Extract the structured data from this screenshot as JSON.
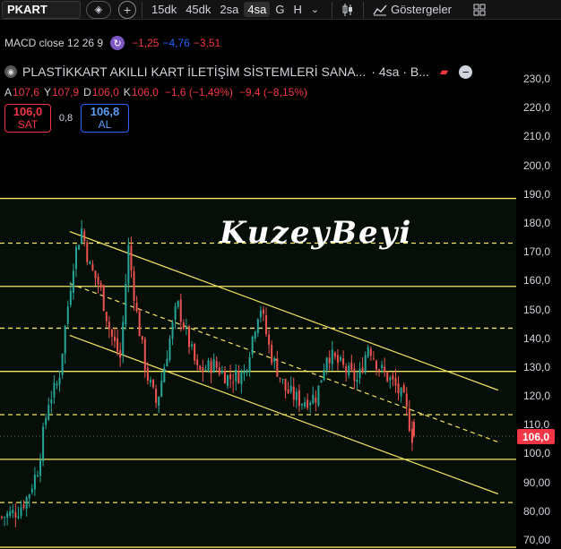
{
  "toolbar": {
    "symbol": "PKART",
    "timeframes": [
      "15dk",
      "45dk",
      "2sa",
      "4sa",
      "G",
      "H"
    ],
    "active_timeframe": "4sa",
    "indicators_label": "Göstergeler"
  },
  "macd": {
    "label": "MACD close 12 26 9",
    "v1": "−1,25",
    "v2": "−4,76",
    "v3": "−3,51"
  },
  "title": {
    "name": "PLASTİKKART AKILLI KART İLETİŞİM SİSTEMLERİ SANA...",
    "suffix": "· 4sa · B..."
  },
  "ohlc": {
    "a_label": "A",
    "a": "107,6",
    "y_label": "Y",
    "y": "107,9",
    "d_label": "D",
    "d": "106,0",
    "k_label": "K",
    "k": "106,0",
    "change": "−1,6 (−1,49%)",
    "change2": "−9,4 (−8,15%)"
  },
  "trade": {
    "sell_price": "106,0",
    "sell_label": "SAT",
    "spread": "0,8",
    "buy_price": "106,8",
    "buy_label": "AL"
  },
  "watermark": "KuzeyBeyi",
  "price_axis": {
    "ticks": [
      "230,0",
      "220,0",
      "210,0",
      "200,0",
      "190,0",
      "180,0",
      "170,0",
      "160,0",
      "150,0",
      "140,0",
      "130,0",
      "120,0",
      "110,0",
      "100,0",
      "90,00",
      "80,00",
      "70,00"
    ],
    "current": "106,0"
  },
  "colors": {
    "background": "#000000",
    "up": "#26a69a",
    "down": "#ef5350",
    "level_line": "#f5e663",
    "badge": "#f23645"
  },
  "chart_data": {
    "type": "candlestick",
    "ylim": [
      67,
      235
    ],
    "current_price": 106.0,
    "horizontal_levels": [
      {
        "price": 188.5,
        "style": "solid"
      },
      {
        "price": 173.0,
        "style": "dashed"
      },
      {
        "price": 158.0,
        "style": "solid"
      },
      {
        "price": 143.5,
        "style": "dashed"
      },
      {
        "price": 128.5,
        "style": "solid"
      },
      {
        "price": 113.5,
        "style": "dashed"
      },
      {
        "price": 98.0,
        "style": "solid"
      },
      {
        "price": 83.0,
        "style": "dashed"
      },
      {
        "price": 67.5,
        "style": "solid"
      }
    ],
    "channel": {
      "upper": [
        [
          0.135,
          177.0
        ],
        [
          0.965,
          122.0
        ]
      ],
      "middle": [
        [
          0.135,
          159.0
        ],
        [
          0.965,
          104.0
        ]
      ],
      "lower": [
        [
          0.135,
          141.0
        ],
        [
          0.965,
          86.0
        ]
      ]
    },
    "close_path": [
      [
        0.0,
        78
      ],
      [
        0.03,
        80
      ],
      [
        0.05,
        85
      ],
      [
        0.07,
        95
      ],
      [
        0.09,
        118
      ],
      [
        0.11,
        125
      ],
      [
        0.12,
        140
      ],
      [
        0.14,
        168
      ],
      [
        0.155,
        178
      ],
      [
        0.17,
        165
      ],
      [
        0.19,
        158
      ],
      [
        0.21,
        142
      ],
      [
        0.23,
        133
      ],
      [
        0.245,
        172
      ],
      [
        0.26,
        150
      ],
      [
        0.28,
        128
      ],
      [
        0.3,
        117
      ],
      [
        0.32,
        135
      ],
      [
        0.34,
        152
      ],
      [
        0.36,
        140
      ],
      [
        0.38,
        128
      ],
      [
        0.41,
        131
      ],
      [
        0.44,
        126
      ],
      [
        0.47,
        128
      ],
      [
        0.5,
        152
      ],
      [
        0.52,
        135
      ],
      [
        0.55,
        122
      ],
      [
        0.58,
        118
      ],
      [
        0.61,
        120
      ],
      [
        0.63,
        135
      ],
      [
        0.66,
        130
      ],
      [
        0.69,
        125
      ],
      [
        0.71,
        138
      ],
      [
        0.73,
        130
      ],
      [
        0.76,
        124
      ],
      [
        0.78,
        118
      ],
      [
        0.795,
        106
      ]
    ]
  }
}
